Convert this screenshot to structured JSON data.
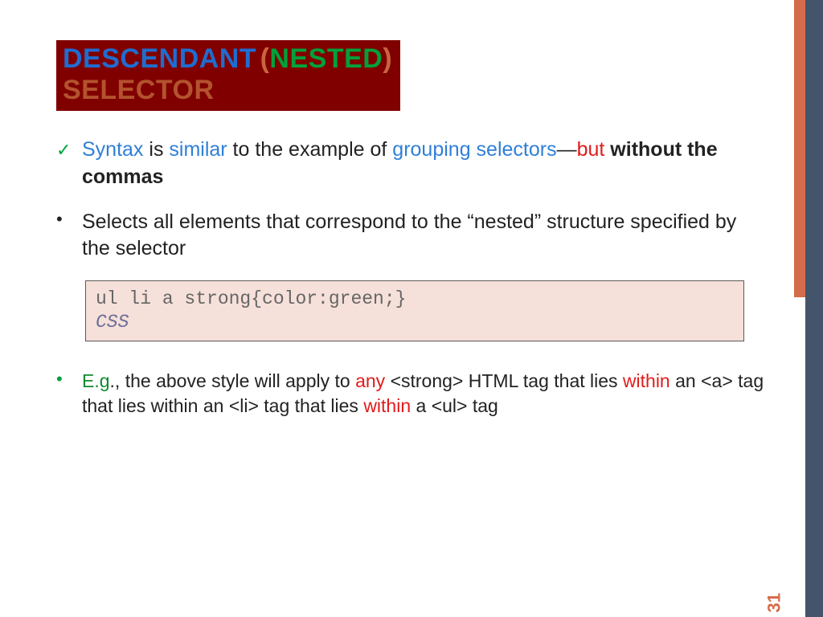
{
  "title": {
    "w1": "DESCENDANT",
    "paren_open": "(",
    "w2": "NESTED",
    "paren_close": ")",
    "w3": "SELECTOR"
  },
  "bullet1": {
    "syntax": "Syntax",
    "is": " is ",
    "similar": "similar",
    "mid": " to the example of ",
    "grouping": "grouping selectors",
    "dash": "—",
    "but": "but",
    "rest": " without the commas"
  },
  "bullet2": "Selects all elements that correspond to the “nested” structure specified by the selector",
  "code": {
    "line": "ul li a strong{color:green;}",
    "label": "CSS"
  },
  "example": {
    "eg": "E.g",
    "p1": "., the above style will apply to ",
    "any": "any",
    "p2": " <strong> HTML tag that lies ",
    "within1": "within",
    "p3": " an <a> tag that lies within an <li> tag that lies ",
    "within2": "within",
    "p4": " a <ul> tag"
  },
  "page": "31"
}
